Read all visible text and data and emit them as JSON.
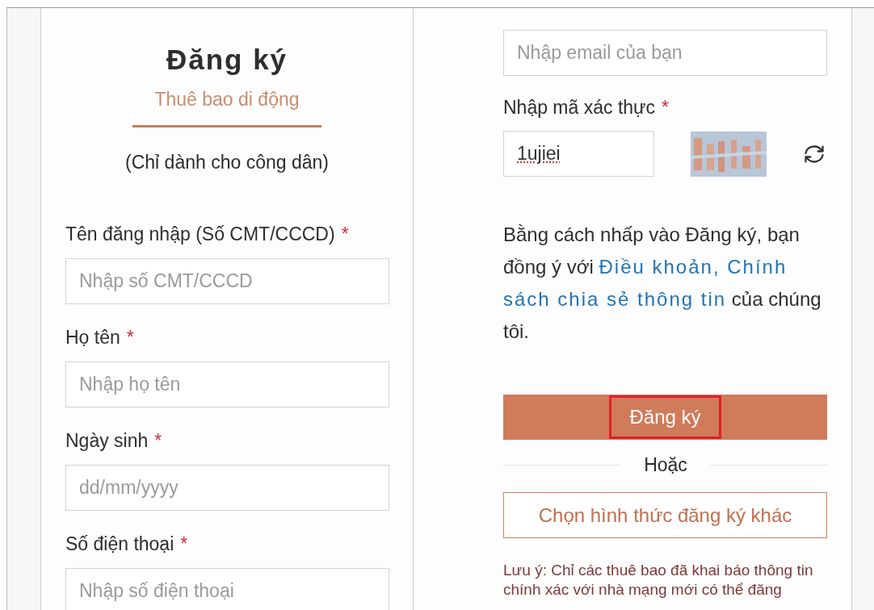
{
  "left": {
    "title": "Đăng ký",
    "tab": {
      "label": "Thuê bao di động",
      "selected": true
    },
    "subtitle": "(Chỉ dành cho công dân)",
    "fields": [
      {
        "label": "Tên đăng nhập (Số CMT/CCCD)",
        "required_mark": "*",
        "placeholder": "Nhập số CMT/CCCD"
      },
      {
        "label": "Họ tên",
        "required_mark": "*",
        "placeholder": "Nhập họ tên"
      },
      {
        "label": "Ngày sinh",
        "required_mark": "*",
        "placeholder": "dd/mm/yyyy"
      },
      {
        "label": "Số điện thoại",
        "required_mark": "*",
        "placeholder": "Nhập số điện thoại"
      }
    ]
  },
  "right": {
    "email": {
      "placeholder": "Nhập email của bạn"
    },
    "captcha": {
      "label": "Nhập mã xác thực",
      "required_mark": "*",
      "value": "1ujiei"
    },
    "consent": {
      "before": "Bằng cách nhấp vào Đăng ký, bạn đồng ý với",
      "link": [
        "Điều khoản, Chính",
        "sách chia sẻ thông tin"
      ],
      "after": "của chúng tôi."
    },
    "submit": {
      "label": "Đăng ký",
      "highlighted": true
    },
    "divider": "Hoặc",
    "alternative": "Chọn hình thức đăng ký khác",
    "note": "Lưu ý: Chỉ các thuê bao đã khai báo thông tin chính xác với nhà mạng mới có thể đăng"
  }
}
